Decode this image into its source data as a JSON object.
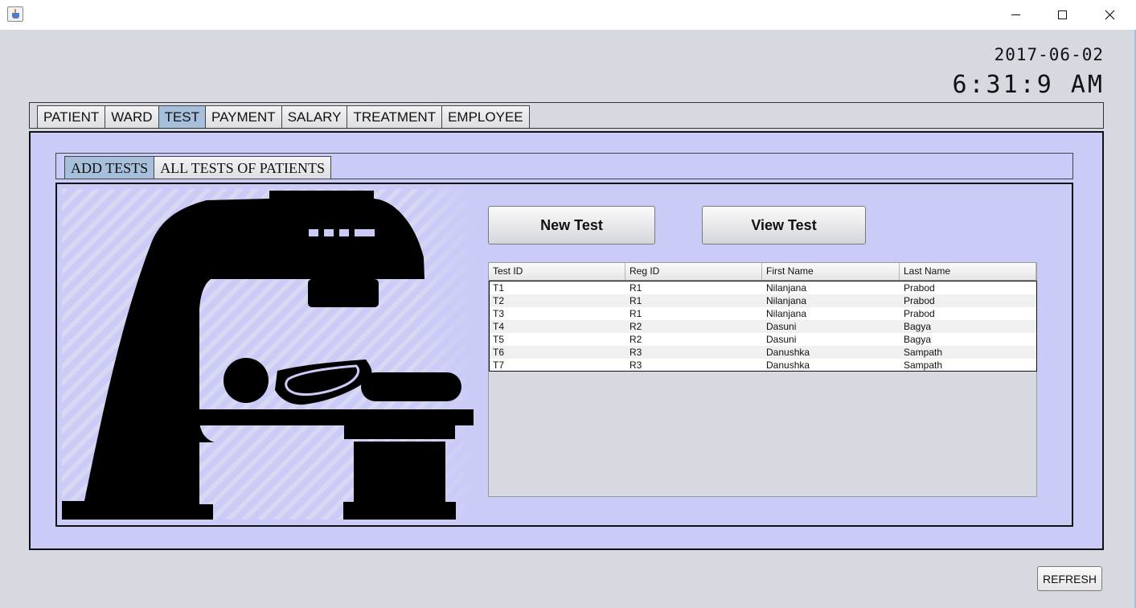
{
  "window": {
    "controls": {
      "minimize_icon": "minimize-icon",
      "maximize_icon": "maximize-icon",
      "close_icon": "close-icon"
    }
  },
  "clock": {
    "date": "2017-06-02",
    "time": "6:31:9 AM"
  },
  "main_tabs": [
    {
      "label": "PATIENT",
      "active": false
    },
    {
      "label": "WARD",
      "active": false
    },
    {
      "label": "TEST",
      "active": true
    },
    {
      "label": "PAYMENT",
      "active": false
    },
    {
      "label": "SALARY",
      "active": false
    },
    {
      "label": "TREATMENT",
      "active": false
    },
    {
      "label": "EMPLOYEE",
      "active": false
    }
  ],
  "sub_tabs": [
    {
      "label": "ADD TESTS",
      "active": true
    },
    {
      "label": "ALL TESTS OF PATIENTS",
      "active": false
    }
  ],
  "illustration": {
    "icon": "mri-scanner-patient-icon"
  },
  "actions": {
    "new_test": "New Test",
    "view_test": "View Test"
  },
  "table": {
    "columns": [
      "Test ID",
      "Reg ID",
      "First Name",
      "Last Name"
    ],
    "rows": [
      [
        "T1",
        "R1",
        "Nilanjana",
        "Prabod"
      ],
      [
        "T2",
        "R1",
        "Nilanjana",
        "Prabod"
      ],
      [
        "T3",
        "R1",
        "Nilanjana",
        "Prabod"
      ],
      [
        "T4",
        "R2",
        "Dasuni",
        "Bagya"
      ],
      [
        "T5",
        "R2",
        "Dasuni",
        "Bagya"
      ],
      [
        "T6",
        "R3",
        "Danushka",
        "Sampath"
      ],
      [
        "T7",
        "R3",
        "Danushka",
        "Sampath"
      ]
    ]
  },
  "footer": {
    "refresh": "REFRESH"
  },
  "colors": {
    "panel": "#cbcbf7",
    "active_tab": "#a6c0db",
    "background": "#d6d9e0"
  }
}
